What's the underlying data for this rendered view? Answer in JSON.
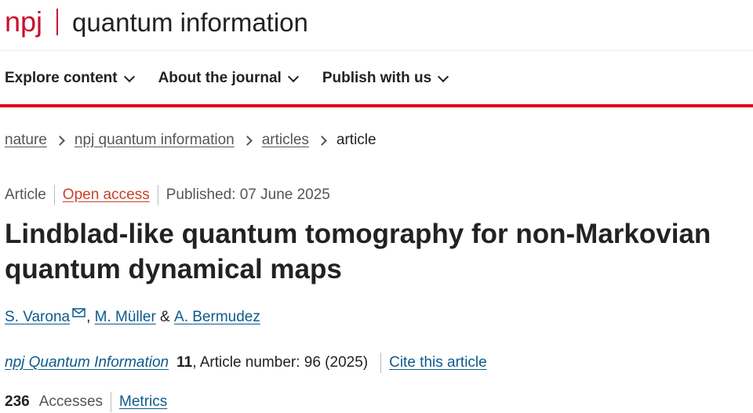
{
  "brand": {
    "logo_text": "npj",
    "journal_title": "quantum information"
  },
  "nav": {
    "items": [
      {
        "label": "Explore content"
      },
      {
        "label": "About the journal"
      },
      {
        "label": "Publish with us"
      }
    ]
  },
  "breadcrumb": {
    "items": [
      "nature",
      "npj quantum information",
      "articles"
    ],
    "current": "article"
  },
  "meta": {
    "type": "Article",
    "access": "Open access",
    "published": "Published: 07 June 2025"
  },
  "article": {
    "title_line1": "Lindblad-like quantum tomography for non-Markovian",
    "title_line2": "quantum dynamical maps"
  },
  "authors": {
    "list": [
      "S. Varona",
      "M. Müller",
      "A. Bermudez"
    ],
    "sep_comma": ", ",
    "sep_amp": " & "
  },
  "citation": {
    "journal": "npj Quantum Information",
    "volume": "11",
    "details": ", Article number: 96 (2025)",
    "cite_label": "Cite this article"
  },
  "metrics": {
    "accesses_count": "236",
    "accesses_label": "Accesses",
    "metrics_label": "Metrics"
  },
  "colors": {
    "brand_red": "#c8102e",
    "accent_bar": "#e00018",
    "link_blue": "#0c5a8c",
    "open_access_orange": "#c8422a"
  }
}
